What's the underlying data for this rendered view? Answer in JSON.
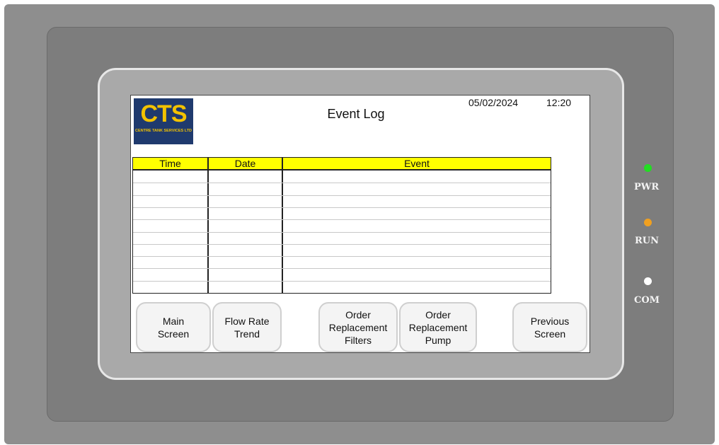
{
  "header": {
    "logo_text": "CTS",
    "logo_subtext": "CENTRE TANK SERVICES LTD",
    "title": "Event Log",
    "date": "05/02/2024",
    "time": "12:20"
  },
  "table": {
    "columns": [
      "Time",
      "Date",
      "Event"
    ],
    "rows": [
      [
        "",
        "",
        ""
      ],
      [
        "",
        "",
        ""
      ],
      [
        "",
        "",
        ""
      ],
      [
        "",
        "",
        ""
      ],
      [
        "",
        "",
        ""
      ],
      [
        "",
        "",
        ""
      ],
      [
        "",
        "",
        ""
      ],
      [
        "",
        "",
        ""
      ],
      [
        "",
        "",
        ""
      ],
      [
        "",
        "",
        ""
      ]
    ]
  },
  "buttons": {
    "main_screen": "Main\nScreen",
    "flow_rate_trend": "Flow Rate\nTrend",
    "order_filters": "Order\nReplacement\nFilters",
    "order_pump": "Order\nReplacement\nPump",
    "previous_screen": "Previous\nScreen"
  },
  "indicators": [
    {
      "label": "PWR",
      "color": "#22dd22"
    },
    {
      "label": "RUN",
      "color": "#f0a020"
    },
    {
      "label": "COM",
      "color": "#ffffff"
    }
  ]
}
